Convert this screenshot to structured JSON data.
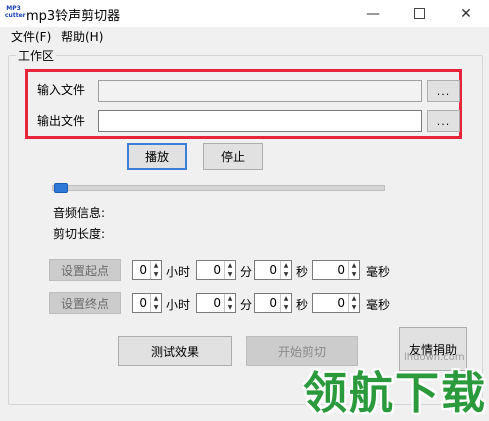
{
  "window": {
    "title": "mp3铃声剪切器",
    "icon_text": "MP3\ncutter"
  },
  "menu": [
    {
      "label": "文件(F)"
    },
    {
      "label": "帮助(H)"
    }
  ],
  "workspace": {
    "group_label": "工作区",
    "input_file_label": "输入文件",
    "output_file_label": "输出文件",
    "input_value": "",
    "output_value": "",
    "browse_label": "...",
    "play_label": "播放",
    "stop_label": "停止",
    "slider_position": 0.0,
    "audio_info_label": "音频信息:",
    "cut_length_label": "剪切长度:"
  },
  "start_time": {
    "button_label": "设置起点",
    "hours": "0",
    "minutes": "0",
    "seconds": "0",
    "millis": "0"
  },
  "end_time": {
    "button_label": "设置终点",
    "hours": "0",
    "minutes": "0",
    "seconds": "0",
    "millis": "0"
  },
  "units": {
    "hour": "小时",
    "minute": "分",
    "second": "秒",
    "milli": "毫秒"
  },
  "actions": {
    "test_label": "测试效果",
    "cut_label": "开始剪切",
    "donate_label": "友情捐助"
  },
  "watermark": {
    "text": "领航下载",
    "site": "lhdown.com"
  },
  "colors": {
    "highlight": "#e8243a",
    "slider_thumb": "#2f78d8",
    "watermark": "#2a9a3c"
  }
}
